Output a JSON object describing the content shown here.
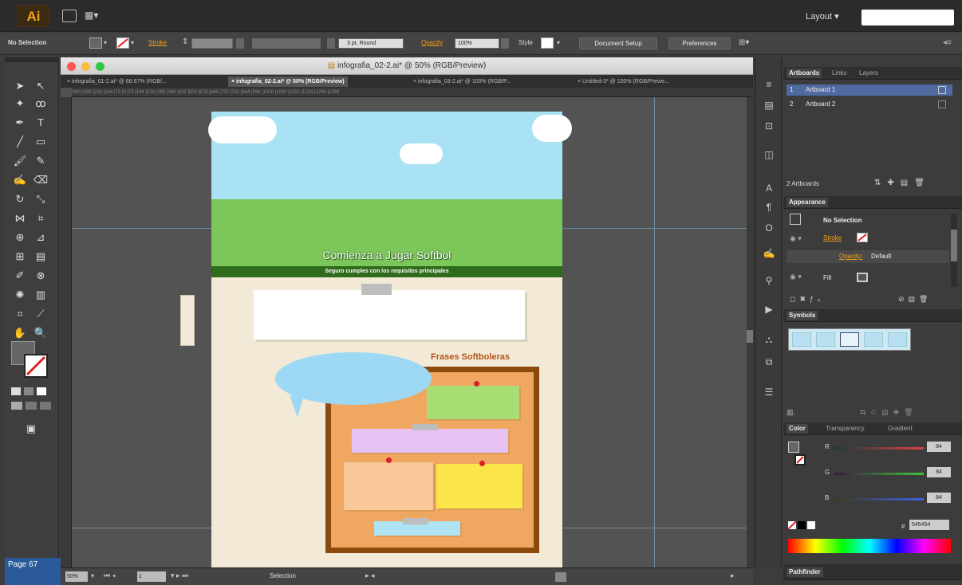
{
  "app": {
    "logo": "Ai",
    "layout_label": "Layout ",
    "layout_caret": "▾"
  },
  "control_bar": {
    "selection_status": "No Selection",
    "stroke_label": "Stroke",
    "brush_value": "3 pt. Round",
    "opacity_label": "Opacity",
    "opacity_value": "100%",
    "style_label": "Style",
    "document_setup": "Document Setup",
    "preferences": "Preferences"
  },
  "document": {
    "window_title": "infografia_02-2.ai* @ 50% (RGB/Preview)",
    "tabs": [
      {
        "label": "infografia_01-2.ai* @ 66.67% (RGB/...",
        "active": false
      },
      {
        "label": "infografia_02-2.ai* @ 50% (RGB/Preview)",
        "active": true
      },
      {
        "label": "infografia_03-2.ai* @ 100% (RGB/P...",
        "active": false
      },
      {
        "label": "Untitled-3* @ 100% (RGB/Previe...",
        "active": false
      }
    ],
    "ruler_ticks": "|360  |288  |216  |144  |72   |0    |72   |144  |216  |288  |360  |432  |504  |576  |648  |720  |792  |864  |936  |1008 |1080 |1152 |1224 |1296 |1368"
  },
  "artwork": {
    "main_title": "Comienza a Jugar Softbol",
    "subtitle_banner": "Seguro cumples con los requisitos principales",
    "board_title": "Frases Softboleras",
    "colors": {
      "sky": "#a9e2f5",
      "grass": "#7cc75a",
      "banner": "#2e6b1a",
      "cream": "#f2ead6",
      "board_frame": "#8c4a0f",
      "board_cork": "#f0a860",
      "bubble": "#9dd8f4",
      "note_green": "#a8de74",
      "note_purple": "#e5c2f3",
      "note_peach": "#f8c79a",
      "note_yellow": "#fae64a",
      "note_blue": "#aee3f3"
    }
  },
  "status_bar": {
    "page_label": "Page 67",
    "zoom": "50%",
    "page_number": "1",
    "tool_name": "Selection"
  },
  "panels": {
    "artboards_tabs": [
      "Artboards",
      "Links",
      "Layers"
    ],
    "artboards": [
      {
        "num": "1",
        "name": "Artboard 1"
      },
      {
        "num": "2",
        "name": "Artboard 2"
      }
    ],
    "artboards_count": "2 Artboards",
    "appearance_title": "Appearance",
    "appearance_selection": "No Selection",
    "appearance_stroke": "Stroke",
    "appearance_opacity": "Opacity:",
    "appearance_opacity_value": "Default",
    "appearance_fill": "Fill",
    "symbols_title": "Symbols",
    "color_tabs": [
      "Color",
      "Transparency",
      "Gradient"
    ],
    "color_channels": [
      {
        "label": "R",
        "value": "84",
        "color": "#e04040"
      },
      {
        "label": "G",
        "value": "84",
        "color": "#40c040"
      },
      {
        "label": "B",
        "value": "84",
        "color": "#4060e0"
      }
    ],
    "hex_label": "#",
    "hex_value": "545454",
    "pathfinder_title": "Pathfinder"
  }
}
